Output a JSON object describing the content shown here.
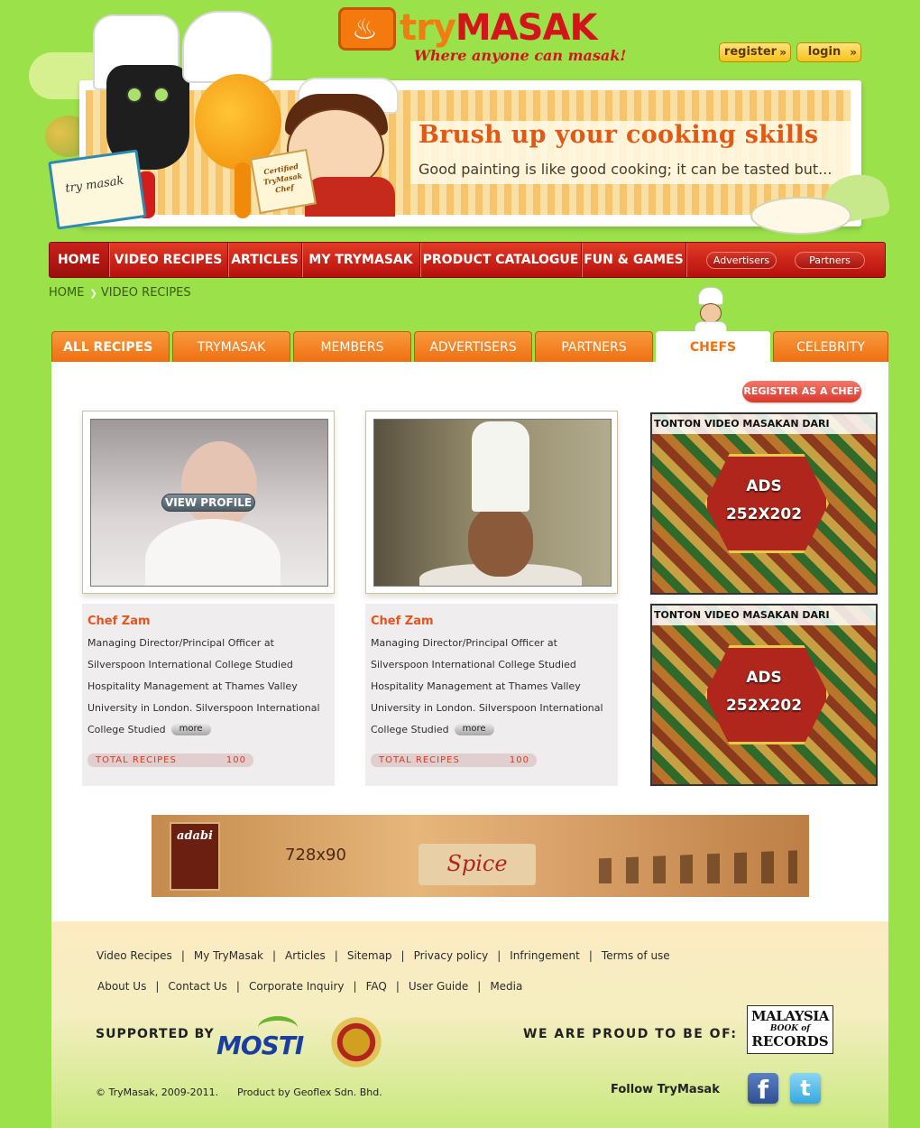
{
  "header": {
    "logo_try": "try",
    "logo_masak": "MASAK",
    "tagline": "Where anyone can masak!",
    "register_label": "register",
    "login_label": "login"
  },
  "banner": {
    "title": "Brush up your cooking skills",
    "subtitle": "Good painting is like good cooking; it can be tasted but...",
    "book_text": "try masak",
    "cert_text": "Certified TryMasak Chef"
  },
  "nav": {
    "items": [
      "HOME",
      "VIDEO RECIPES",
      "ARTICLES",
      "MY TRYMASAK",
      "PRODUCT CATALOGUE",
      "FUN & GAMES"
    ],
    "active": "HOME",
    "advertisers": "Advertisers",
    "partners": "Partners"
  },
  "breadcrumb": {
    "home": "HOME",
    "current": "VIDEO RECIPES"
  },
  "tabs": {
    "items": [
      "ALL RECIPES",
      "TRYMASAK",
      "MEMBERS",
      "ADVERTISERS",
      "PARTNERS",
      "CHEFS",
      "CELEBRITY"
    ],
    "active": "CHEFS"
  },
  "register_chef_label": "REGISTER AS A CHEF",
  "chefs": [
    {
      "name": "Chef Zam",
      "description": "Managing Director/Principal Officer at Silverspoon International College Studied Hospitality Management at Thames Valley University in London. Silverspoon International College Studied",
      "more_label": "more",
      "total_label": "TOTAL RECIPES",
      "total_value": "100",
      "overlay_label": "VIEW PROFILE"
    },
    {
      "name": "Chef Zam",
      "description": "Managing Director/Principal Officer at Silverspoon International College Studied Hospitality Management at Thames Valley University in London. Silverspoon International College Studied",
      "more_label": "more",
      "total_label": "TOTAL RECIPES",
      "total_value": "100"
    }
  ],
  "ads": [
    {
      "top_text": "TONTON VIDEO MASAKAN DARI",
      "label": "ADS",
      "size": "252X202"
    },
    {
      "top_text": "TONTON VIDEO MASAKAN DARI",
      "label": "ADS",
      "size": "252X202"
    }
  ],
  "leaderboard": {
    "size": "728x90",
    "brand": "adabi",
    "product": "Spice"
  },
  "footer": {
    "links_row1": [
      "Video Recipes",
      "My TryMasak",
      "Articles",
      "Sitemap",
      "Privacy policy",
      "Infringement",
      "Terms of use"
    ],
    "links_row2": [
      "About Us",
      "Contact Us",
      "Corporate Inquiry",
      "FAQ",
      "User Guide",
      "Media"
    ],
    "supported_by": "SUPPORTED BY",
    "mosti": "MOSTI",
    "proud": "WE ARE PROUD TO BE OF:",
    "mbr_line1": "MALAYSIA",
    "mbr_line2": "RECORDS",
    "copyright": "© TryMasak, 2009-2011.",
    "product_by": "Product by Geoflex Sdn. Bhd.",
    "follow": "Follow TryMasak",
    "facebook": "f",
    "twitter": "t"
  },
  "colors": {
    "page_bg": "#9be14a",
    "nav_red": "#c91a14",
    "tab_orange": "#ef6f12",
    "accent_orange": "#e6531d"
  }
}
